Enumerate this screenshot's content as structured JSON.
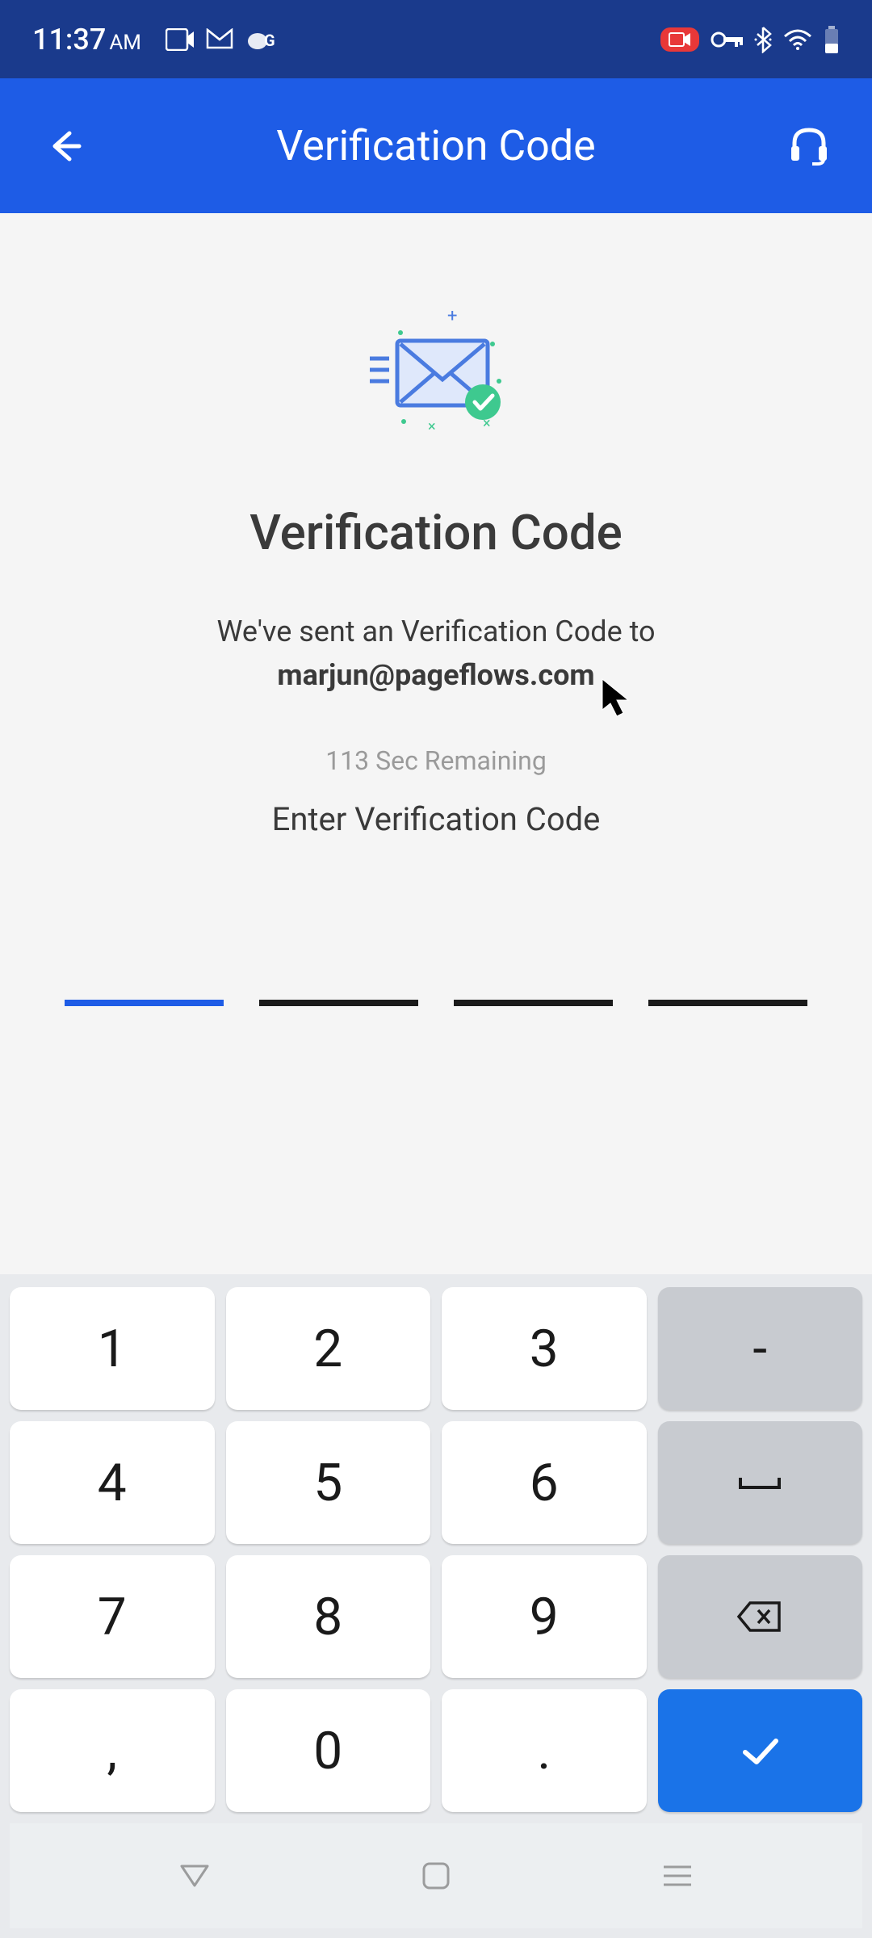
{
  "status_bar": {
    "time": "11:37",
    "ampm": "AM"
  },
  "app_bar": {
    "title": "Verification Code"
  },
  "content": {
    "heading": "Verification Code",
    "sent_line1": "We've sent an Verification Code to",
    "email": "marjun@pageflows.com",
    "timer": "113 Sec Remaining",
    "enter_label": "Enter Verification Code"
  },
  "keypad": {
    "k1": "1",
    "k2": "2",
    "k3": "3",
    "dash": "-",
    "k4": "4",
    "k5": "5",
    "k6": "6",
    "k7": "7",
    "k8": "8",
    "k9": "9",
    "comma": ",",
    "k0": "0",
    "dot": "."
  }
}
